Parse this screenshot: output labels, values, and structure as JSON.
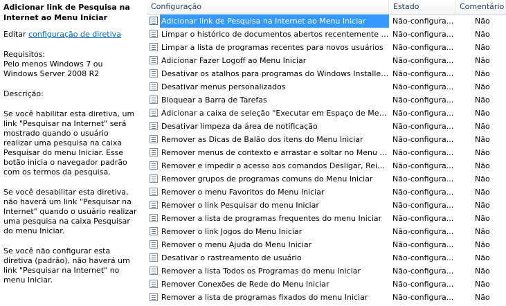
{
  "description": {
    "title": "Adicionar link de Pesquisa na Internet ao Menu Iniciar",
    "edit_prefix": "Editar ",
    "edit_link": "configuração de diretiva",
    "requirements_label": "Requisitos:",
    "requirements_text": "Pelo menos Windows 7 ou Windows Server 2008 R2",
    "description_label": "Descrição:",
    "para1": "Se você habilitar esta diretiva, um link \"Pesquisar na Internet\" será mostrado quando o usuário realizar uma pesquisa na caixa Pesquisar do menu Iniciar. Esse botão inicia o navegador padrão com os termos da pesquisa.",
    "para2": "Se você desabilitar esta diretiva, não haverá um link \"Pesquisar na Internet\" quando o usuário realizar uma pesquisa na caixa Pesquisar do menu Iniciar.",
    "para3": "Se você não configurar esta diretiva (padrão), não haverá um link \"Pesquisar na Internet\" no menu Iniciar."
  },
  "table": {
    "columns": [
      "Configuração",
      "Estado",
      "Comentário"
    ],
    "rows": [
      {
        "setting": "Adicionar link de Pesquisa na Internet ao Menu Iniciar",
        "state": "Não-configura...",
        "comment": "Não"
      },
      {
        "setting": "Limpar o histórico de documentos abertos recentemente ao...",
        "state": "Não-configura...",
        "comment": "Não"
      },
      {
        "setting": "Limpar a lista de programas recentes para novos usuários",
        "state": "Não-configura...",
        "comment": "Não"
      },
      {
        "setting": "Adicionar Fazer Logoff ao Menu Iniciar",
        "state": "Não-configura...",
        "comment": "Não"
      },
      {
        "setting": "Desativar os atalhos para programas do Windows Installer n...",
        "state": "Não-configura...",
        "comment": "Não"
      },
      {
        "setting": "Desativar menus personalizados",
        "state": "Não-configura...",
        "comment": "Não"
      },
      {
        "setting": "Bloquear a Barra de Tarefas",
        "state": "Não-configura...",
        "comment": "Não"
      },
      {
        "setting": "Adicionar a caixa de seleção \"Executar em Espaço de Memór...",
        "state": "Não-configura...",
        "comment": "Não"
      },
      {
        "setting": "Desativar limpeza da área de notificação",
        "state": "Não-configura...",
        "comment": "Não"
      },
      {
        "setting": "Remover as Dicas de Balão dos itens do Menu Iniciar",
        "state": "Não-configura...",
        "comment": "Não"
      },
      {
        "setting": "Remover menus de contexto e arrastar e soltar no Menu Inici...",
        "state": "Não-configura...",
        "comment": "Não"
      },
      {
        "setting": "Remover e impedir o acesso aos comandos Desligar, Reinici...",
        "state": "Não-configura...",
        "comment": "Não"
      },
      {
        "setting": "Remover grupos de programas comuns do Menu Iniciar",
        "state": "Não-configura...",
        "comment": "Não"
      },
      {
        "setting": "Remover o menu Favoritos do Menu Iniciar",
        "state": "Não-configura...",
        "comment": "Não"
      },
      {
        "setting": "Remover o link Pesquisar do menu Iniciar",
        "state": "Não-configura...",
        "comment": "Não"
      },
      {
        "setting": "Remover a lista de programas frequentes do menu Iniciar",
        "state": "Não-configura...",
        "comment": "Não"
      },
      {
        "setting": "Remover o link Jogos do Menu Iniciar",
        "state": "Não-configura...",
        "comment": "Não"
      },
      {
        "setting": "Remover o menu Ajuda do Menu Iniciar",
        "state": "Não-configura...",
        "comment": "Não"
      },
      {
        "setting": "Desativar o rastreamento de usuário",
        "state": "Não-configura...",
        "comment": "Não"
      },
      {
        "setting": "Remover a lista Todos os Programas do menu Iniciar",
        "state": "Não-configura...",
        "comment": "Não"
      },
      {
        "setting": "Remover Conexões de Rede do Menu Iniciar",
        "state": "Não-configura...",
        "comment": "Não"
      },
      {
        "setting": "Remover a lista de programas fixados do menu Iniciar",
        "state": "Não-configura...",
        "comment": "Não"
      }
    ]
  },
  "icons": {
    "setting_row": "policy-setting-icon"
  },
  "colors": {
    "selection": "#3399ff",
    "link": "#0066cc",
    "header_text": "#1e395b"
  }
}
